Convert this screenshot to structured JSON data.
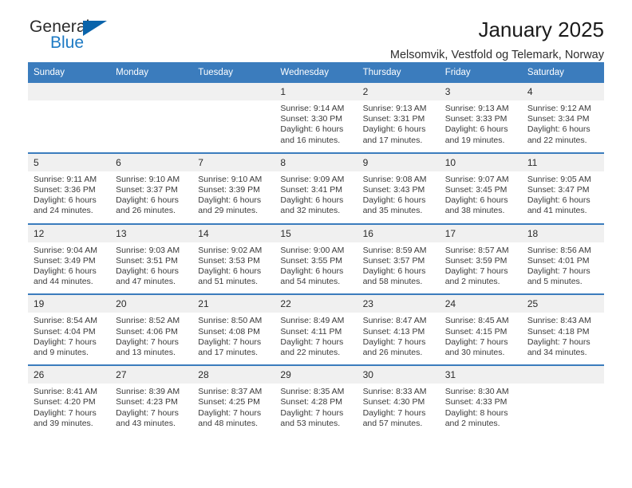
{
  "brand": {
    "name_part1": "General",
    "name_part2": "Blue",
    "triangle_color": "#0a64ab",
    "blue_color": "#1d7ac4"
  },
  "header": {
    "title": "January 2025",
    "subtitle": "Melsomvik, Vestfold og Telemark, Norway",
    "header_bg": "#3b7cbd",
    "daynum_bg": "#f0f0f0"
  },
  "weekdays": [
    "Sunday",
    "Monday",
    "Tuesday",
    "Wednesday",
    "Thursday",
    "Friday",
    "Saturday"
  ],
  "weeks": [
    {
      "days": [
        {
          "num": "",
          "lines": []
        },
        {
          "num": "",
          "lines": []
        },
        {
          "num": "",
          "lines": []
        },
        {
          "num": "1",
          "lines": [
            "Sunrise: 9:14 AM",
            "Sunset: 3:30 PM",
            "Daylight: 6 hours",
            "and 16 minutes."
          ]
        },
        {
          "num": "2",
          "lines": [
            "Sunrise: 9:13 AM",
            "Sunset: 3:31 PM",
            "Daylight: 6 hours",
            "and 17 minutes."
          ]
        },
        {
          "num": "3",
          "lines": [
            "Sunrise: 9:13 AM",
            "Sunset: 3:33 PM",
            "Daylight: 6 hours",
            "and 19 minutes."
          ]
        },
        {
          "num": "4",
          "lines": [
            "Sunrise: 9:12 AM",
            "Sunset: 3:34 PM",
            "Daylight: 6 hours",
            "and 22 minutes."
          ]
        }
      ]
    },
    {
      "days": [
        {
          "num": "5",
          "lines": [
            "Sunrise: 9:11 AM",
            "Sunset: 3:36 PM",
            "Daylight: 6 hours",
            "and 24 minutes."
          ]
        },
        {
          "num": "6",
          "lines": [
            "Sunrise: 9:10 AM",
            "Sunset: 3:37 PM",
            "Daylight: 6 hours",
            "and 26 minutes."
          ]
        },
        {
          "num": "7",
          "lines": [
            "Sunrise: 9:10 AM",
            "Sunset: 3:39 PM",
            "Daylight: 6 hours",
            "and 29 minutes."
          ]
        },
        {
          "num": "8",
          "lines": [
            "Sunrise: 9:09 AM",
            "Sunset: 3:41 PM",
            "Daylight: 6 hours",
            "and 32 minutes."
          ]
        },
        {
          "num": "9",
          "lines": [
            "Sunrise: 9:08 AM",
            "Sunset: 3:43 PM",
            "Daylight: 6 hours",
            "and 35 minutes."
          ]
        },
        {
          "num": "10",
          "lines": [
            "Sunrise: 9:07 AM",
            "Sunset: 3:45 PM",
            "Daylight: 6 hours",
            "and 38 minutes."
          ]
        },
        {
          "num": "11",
          "lines": [
            "Sunrise: 9:05 AM",
            "Sunset: 3:47 PM",
            "Daylight: 6 hours",
            "and 41 minutes."
          ]
        }
      ]
    },
    {
      "days": [
        {
          "num": "12",
          "lines": [
            "Sunrise: 9:04 AM",
            "Sunset: 3:49 PM",
            "Daylight: 6 hours",
            "and 44 minutes."
          ]
        },
        {
          "num": "13",
          "lines": [
            "Sunrise: 9:03 AM",
            "Sunset: 3:51 PM",
            "Daylight: 6 hours",
            "and 47 minutes."
          ]
        },
        {
          "num": "14",
          "lines": [
            "Sunrise: 9:02 AM",
            "Sunset: 3:53 PM",
            "Daylight: 6 hours",
            "and 51 minutes."
          ]
        },
        {
          "num": "15",
          "lines": [
            "Sunrise: 9:00 AM",
            "Sunset: 3:55 PM",
            "Daylight: 6 hours",
            "and 54 minutes."
          ]
        },
        {
          "num": "16",
          "lines": [
            "Sunrise: 8:59 AM",
            "Sunset: 3:57 PM",
            "Daylight: 6 hours",
            "and 58 minutes."
          ]
        },
        {
          "num": "17",
          "lines": [
            "Sunrise: 8:57 AM",
            "Sunset: 3:59 PM",
            "Daylight: 7 hours",
            "and 2 minutes."
          ]
        },
        {
          "num": "18",
          "lines": [
            "Sunrise: 8:56 AM",
            "Sunset: 4:01 PM",
            "Daylight: 7 hours",
            "and 5 minutes."
          ]
        }
      ]
    },
    {
      "days": [
        {
          "num": "19",
          "lines": [
            "Sunrise: 8:54 AM",
            "Sunset: 4:04 PM",
            "Daylight: 7 hours",
            "and 9 minutes."
          ]
        },
        {
          "num": "20",
          "lines": [
            "Sunrise: 8:52 AM",
            "Sunset: 4:06 PM",
            "Daylight: 7 hours",
            "and 13 minutes."
          ]
        },
        {
          "num": "21",
          "lines": [
            "Sunrise: 8:50 AM",
            "Sunset: 4:08 PM",
            "Daylight: 7 hours",
            "and 17 minutes."
          ]
        },
        {
          "num": "22",
          "lines": [
            "Sunrise: 8:49 AM",
            "Sunset: 4:11 PM",
            "Daylight: 7 hours",
            "and 22 minutes."
          ]
        },
        {
          "num": "23",
          "lines": [
            "Sunrise: 8:47 AM",
            "Sunset: 4:13 PM",
            "Daylight: 7 hours",
            "and 26 minutes."
          ]
        },
        {
          "num": "24",
          "lines": [
            "Sunrise: 8:45 AM",
            "Sunset: 4:15 PM",
            "Daylight: 7 hours",
            "and 30 minutes."
          ]
        },
        {
          "num": "25",
          "lines": [
            "Sunrise: 8:43 AM",
            "Sunset: 4:18 PM",
            "Daylight: 7 hours",
            "and 34 minutes."
          ]
        }
      ]
    },
    {
      "days": [
        {
          "num": "26",
          "lines": [
            "Sunrise: 8:41 AM",
            "Sunset: 4:20 PM",
            "Daylight: 7 hours",
            "and 39 minutes."
          ]
        },
        {
          "num": "27",
          "lines": [
            "Sunrise: 8:39 AM",
            "Sunset: 4:23 PM",
            "Daylight: 7 hours",
            "and 43 minutes."
          ]
        },
        {
          "num": "28",
          "lines": [
            "Sunrise: 8:37 AM",
            "Sunset: 4:25 PM",
            "Daylight: 7 hours",
            "and 48 minutes."
          ]
        },
        {
          "num": "29",
          "lines": [
            "Sunrise: 8:35 AM",
            "Sunset: 4:28 PM",
            "Daylight: 7 hours",
            "and 53 minutes."
          ]
        },
        {
          "num": "30",
          "lines": [
            "Sunrise: 8:33 AM",
            "Sunset: 4:30 PM",
            "Daylight: 7 hours",
            "and 57 minutes."
          ]
        },
        {
          "num": "31",
          "lines": [
            "Sunrise: 8:30 AM",
            "Sunset: 4:33 PM",
            "Daylight: 8 hours",
            "and 2 minutes."
          ]
        },
        {
          "num": "",
          "lines": []
        }
      ]
    }
  ]
}
